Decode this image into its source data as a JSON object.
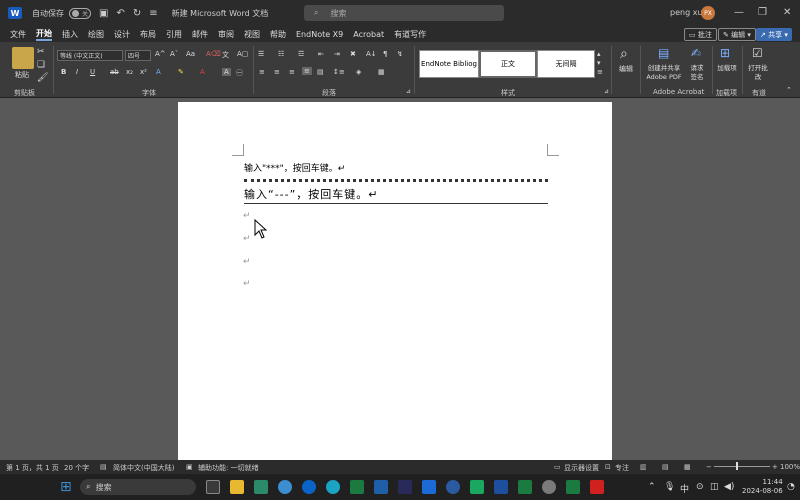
{
  "titlebar": {
    "app_icon": "W",
    "autosave_label": "自动保存",
    "autosave_state": "关",
    "doc_title": "新建 Microsoft Word 文档",
    "search_placeholder": "搜索",
    "user_name": "peng xu",
    "user_initials": "PX"
  },
  "menu": {
    "items": [
      "文件",
      "开始",
      "插入",
      "绘图",
      "设计",
      "布局",
      "引用",
      "邮件",
      "审阅",
      "视图",
      "帮助",
      "EndNote X9",
      "Acrobat",
      "有道写作"
    ],
    "active": "开始",
    "comment_label": "批注",
    "edit_label": "编辑",
    "share_label": "共享"
  },
  "ribbon": {
    "clipboard": {
      "paste_label": "粘贴",
      "group_label": "剪贴板"
    },
    "font": {
      "font_name": "等线 (中文正文)",
      "font_size": "四号",
      "group_label": "字体"
    },
    "paragraph": {
      "group_label": "段落"
    },
    "styles": {
      "items": [
        "EndNote Bibliog",
        "正文",
        "无间隔"
      ],
      "group_label": "样式"
    },
    "editing": {
      "label": "编辑"
    },
    "acrobat": {
      "create_pdf": "创建并共享 Adobe PDF",
      "request_sign": "请求签名",
      "group_label": "Adobe Acrobat"
    },
    "addins": {
      "load_label": "加载项",
      "group_label": "加载项"
    },
    "youdao": {
      "open_label": "打开批改",
      "group_label": "有道"
    }
  },
  "document": {
    "line1": "输入\"***\"，按回车键。↵",
    "line2": "输入“---”，按回车键。↵",
    "para_marks": [
      "↵",
      "↵",
      "↵",
      "↵"
    ]
  },
  "status": {
    "page": "第 1 页，共 1 页",
    "words": "20 个字",
    "language": "简体中文(中国大陆)",
    "accessibility": "辅助功能: 一切就绪",
    "display_settings": "显示器设置",
    "focus": "专注",
    "zoom": "100%"
  },
  "taskbar": {
    "search_label": "搜索",
    "time": "11:44",
    "date": "2024-08-06",
    "ime": "中"
  }
}
